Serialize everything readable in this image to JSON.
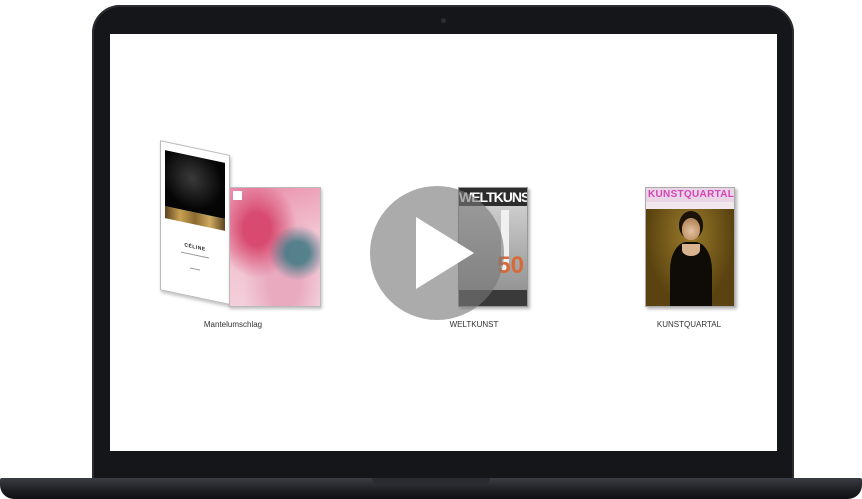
{
  "products": [
    {
      "label": "Mantelumschlag",
      "cover_title": "CÉLINE"
    },
    {
      "label": "WELTKUNST",
      "cover_masthead": "WELTKUNST",
      "cover_number": "50"
    },
    {
      "label": "KUNSTQUARTAL",
      "cover_masthead": "KUNSTQUARTAL"
    }
  ],
  "video": {
    "state": "paused"
  },
  "colors": {
    "bezel": "#15161a",
    "screen": "#ffffff",
    "play_overlay": "#787878",
    "kunstquartal_masthead": "#d645b6"
  }
}
